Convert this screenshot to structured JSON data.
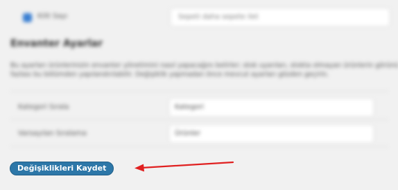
{
  "top_row": {
    "checkbox_label": "Kilit Sayı",
    "input_placeholder": "Sepeti daha sepete ilet"
  },
  "section": {
    "heading": "Envanter Ayarlar",
    "description_lines": [
      "Bu ayarları ürünlerinizin envanter yönetimini nasıl yapacağını belirler; stok uyarıları, stokta olmayan ürünlerin görünürlüğü ve daha",
      "fazlası bu bölümden yapılandırılabilir. Değişiklik yapmadan önce mevcut ayarları gözden geçirin."
    ]
  },
  "fields": [
    {
      "label": "Kategori Sırala",
      "value": "Kategori"
    },
    {
      "label": "Varsayılan Sıralama",
      "value": "Ürünler"
    }
  ],
  "save_button": {
    "label": "Değişiklikleri Kaydet"
  },
  "annotation": {
    "arrow_color": "#e02020"
  },
  "colors": {
    "background": "#f1f1f1",
    "button": "#2d77a8",
    "checkbox": "#3a7fd2"
  }
}
